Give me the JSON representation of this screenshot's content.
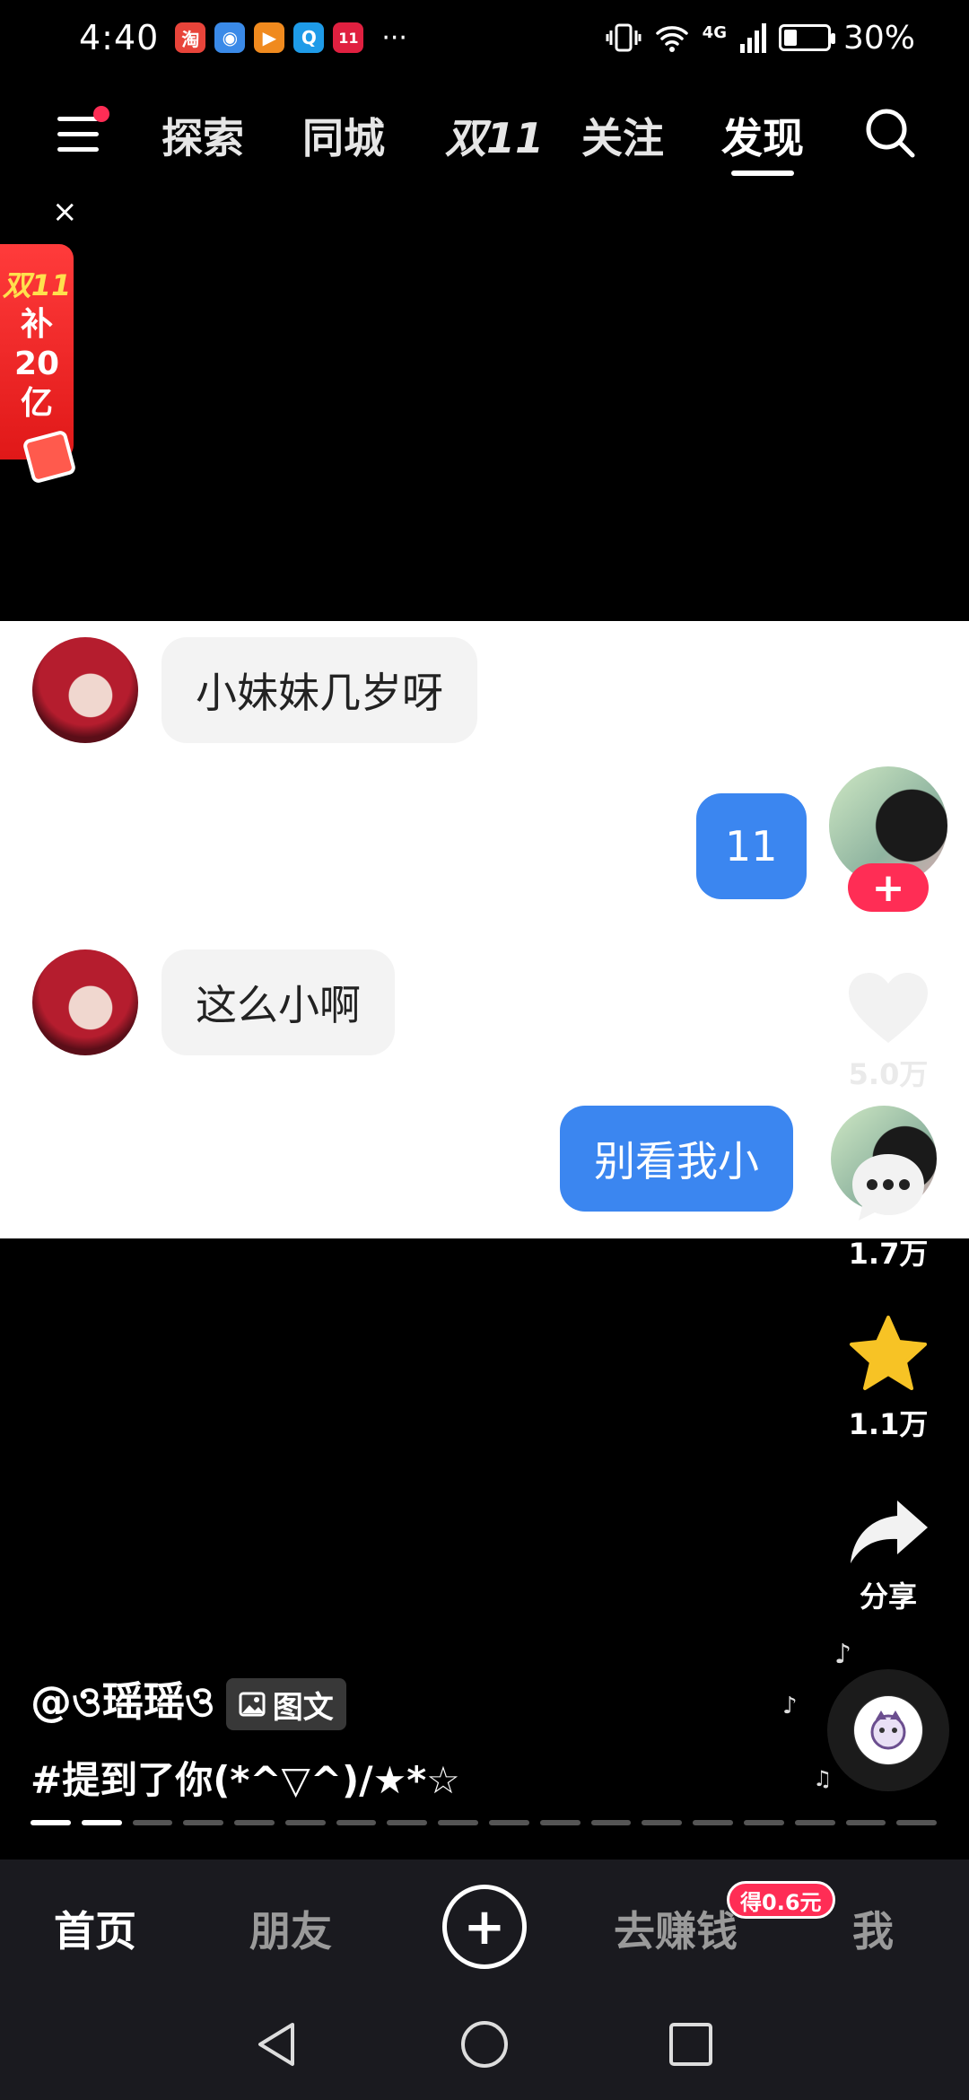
{
  "status_bar": {
    "time": "4:40",
    "app_icons": [
      {
        "label": "淘",
        "color": "#e8443a"
      },
      {
        "label": "◉",
        "color": "#3a8ae8"
      },
      {
        "label": "▶",
        "color": "#f08a1e"
      },
      {
        "label": "Q",
        "color": "#1e9be8"
      },
      {
        "label": "11",
        "color": "#e02040"
      }
    ],
    "more": "···",
    "network": "4G",
    "battery": "30%",
    "battery_level": 0.3
  },
  "top_nav": {
    "tabs": [
      "探索",
      "同城",
      "双11",
      "关注",
      "发现"
    ],
    "active_tab": "发现"
  },
  "promo": {
    "close": "×",
    "lines": [
      "双11",
      "补",
      "20",
      "亿"
    ]
  },
  "chat": {
    "messages": [
      {
        "side": "left",
        "text": "小妹妹几岁呀"
      },
      {
        "side": "right",
        "text": "11"
      },
      {
        "side": "left",
        "text": "这么小啊"
      },
      {
        "side": "right",
        "text": "别看我小"
      }
    ]
  },
  "rail": {
    "follow": "+",
    "likes": "5.0万",
    "comments": "1.7万",
    "favorites": "1.1万",
    "share": "分享"
  },
  "caption": {
    "author": "@ও瑶瑶ও",
    "tag_chip": "图文",
    "hashtag": "#提到了你(*^▽^)/★*☆"
  },
  "progress": {
    "total": 18,
    "active": 2
  },
  "bottom_nav": {
    "items": [
      "首页",
      "朋友",
      "去赚钱",
      "我"
    ],
    "add": "+",
    "earn_badge": "得0.6元"
  },
  "colors": {
    "accent": "#ff2d55",
    "bubble_right": "#3b86f0",
    "star": "#f7c325"
  }
}
